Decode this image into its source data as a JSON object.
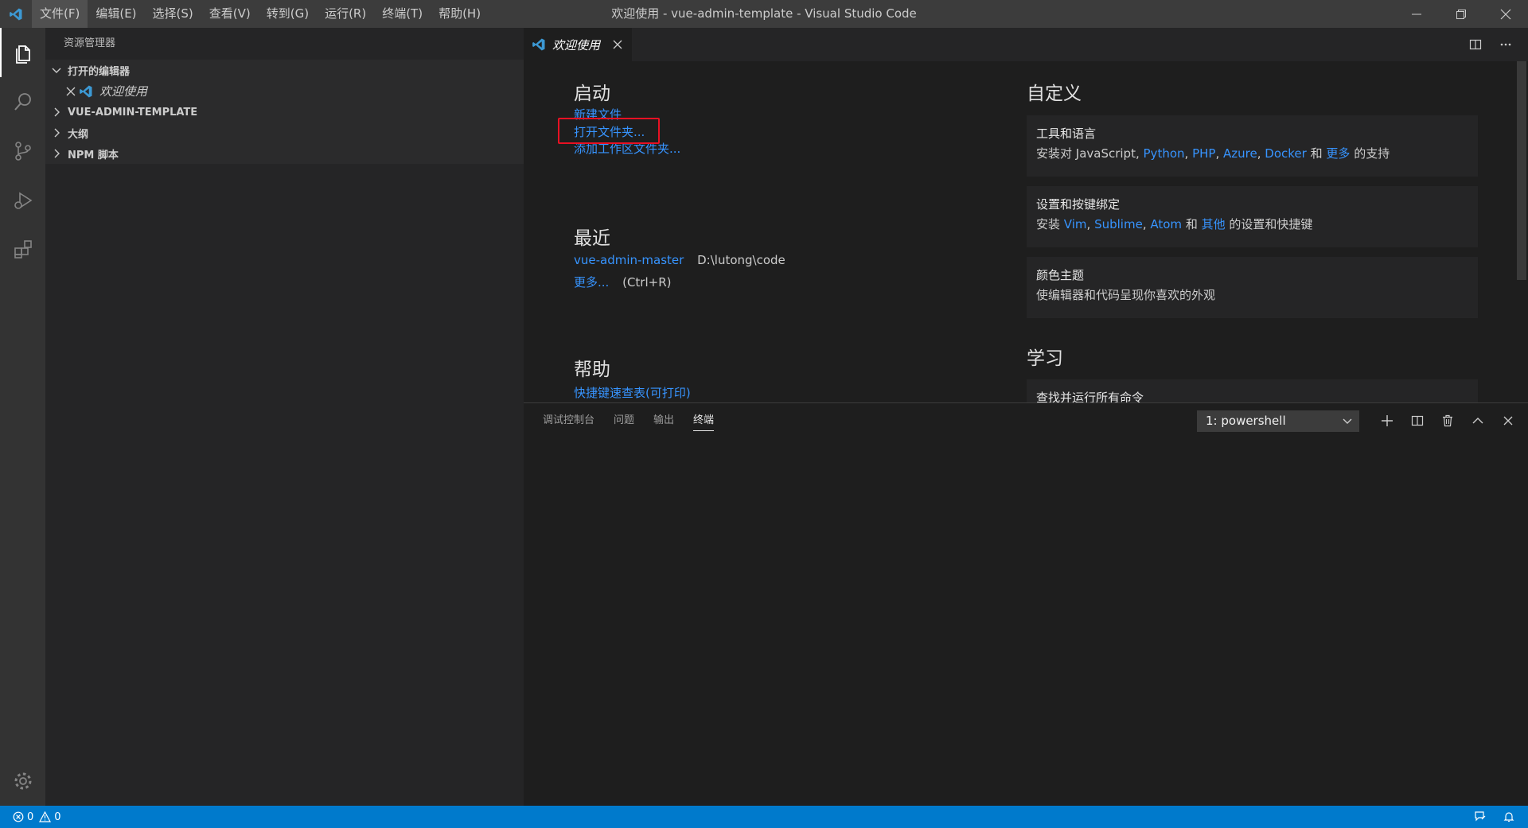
{
  "window": {
    "title": "欢迎使用 - vue-admin-template - Visual Studio Code"
  },
  "menu": [
    "文件(F)",
    "编辑(E)",
    "选择(S)",
    "查看(V)",
    "转到(G)",
    "运行(R)",
    "终端(T)",
    "帮助(H)"
  ],
  "sidebar": {
    "title": "资源管理器",
    "sections": {
      "open_editors": "打开的编辑器",
      "project": "VUE-ADMIN-TEMPLATE",
      "outline": "大纲",
      "npm": "NPM 脚本"
    },
    "open_editor_item": "欢迎使用"
  },
  "tab": {
    "label": "欢迎使用"
  },
  "welcome": {
    "start": {
      "heading": "启动",
      "new_file": "新建文件",
      "open_folder": "打开文件夹...",
      "add_workspace": "添加工作区文件夹..."
    },
    "recent": {
      "heading": "最近",
      "item_name": "vue-admin-master",
      "item_path": "D:\\lutong\\code",
      "more": "更多...",
      "more_shortcut": "(Ctrl+R)"
    },
    "help": {
      "heading": "帮助",
      "shortcuts": "快捷键速查表(可打印)"
    },
    "customize": {
      "heading": "自定义",
      "tools": {
        "title": "工具和语言",
        "prefix": "安装对 JavaScript,",
        "python": "Python",
        "sep1": ",",
        "php": "PHP",
        "sep2": ",",
        "azure": "Azure",
        "sep3": ",",
        "docker": "Docker",
        "and": "和",
        "more": "更多",
        "suffix": "的支持"
      },
      "keybindings": {
        "title": "设置和按键绑定",
        "prefix": "安装",
        "vim": "Vim",
        "sep1": ",",
        "sublime": "Sublime",
        "sep2": ",",
        "atom": "Atom",
        "and": "和",
        "other": "其他",
        "suffix": "的设置和快捷键"
      },
      "theme": {
        "title": "颜色主题",
        "desc": "使编辑器和代码呈现你喜欢的外观"
      }
    },
    "learn": {
      "heading": "学习",
      "first_item": "查找并运行所有命令"
    }
  },
  "panel": {
    "tabs": [
      "调试控制台",
      "问题",
      "输出",
      "终端"
    ],
    "active_tab": "终端",
    "terminal_select": "1: powershell"
  },
  "statusbar": {
    "errors": "0",
    "warnings": "0"
  },
  "colors": {
    "accent": "#007acc",
    "link": "#3794ff",
    "highlight": "#e81123"
  }
}
